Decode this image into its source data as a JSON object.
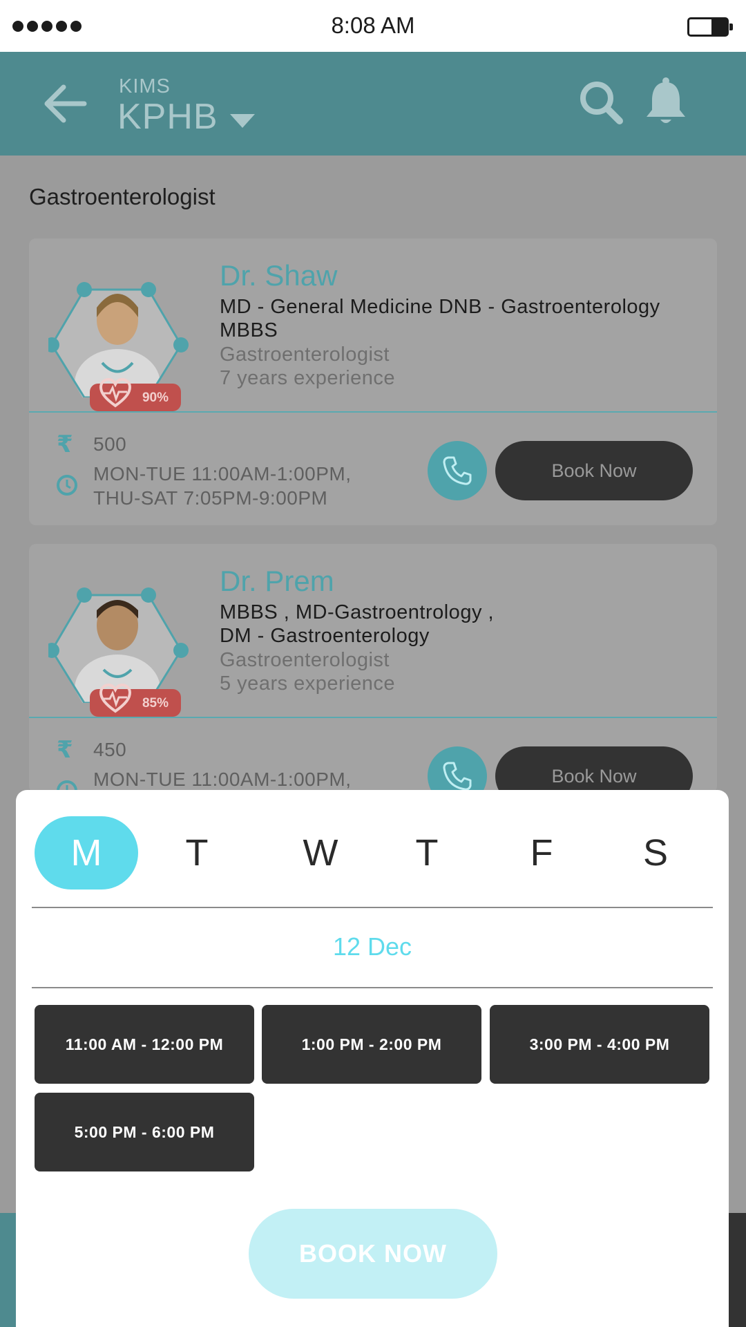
{
  "status_bar": {
    "time": "8:08 AM"
  },
  "header": {
    "hospital": "KIMS",
    "location": "KPHB"
  },
  "section_title": "Gastroenterologist",
  "doctors": [
    {
      "name": "Dr. Shaw",
      "quals": "MD - General Medicine DNB - Gastroenterology MBBS",
      "specialty": "Gastroenterologist",
      "experience": "7 years experience",
      "rating": "90%",
      "fee": "500",
      "timings": [
        "MON-TUE 11:00AM-1:00PM,",
        "THU-SAT 7:05PM-9:00PM"
      ],
      "book_label": "Book Now"
    },
    {
      "name": "Dr. Prem",
      "quals": "MBBS , MD-Gastroentrology , DM - Gastroenterology",
      "specialty": "Gastroenterologist",
      "experience": "5 years experience",
      "rating": "85%",
      "fee": "450",
      "timings": [
        "MON-TUE 11:00AM-1:00PM,",
        ""
      ],
      "book_label": "Book Now"
    }
  ],
  "booking_sheet": {
    "days": [
      "M",
      "T",
      "W",
      "T",
      "F",
      "S"
    ],
    "selected_day": "M",
    "date": "12 Dec",
    "slots": [
      "11:00 AM - 12:00 PM",
      "1:00 PM - 2:00 PM",
      "3:00 PM - 4:00 PM",
      "5:00 PM - 6:00 PM"
    ],
    "book_button": "BOOK NOW"
  },
  "colors": {
    "header": "#4e8a8f",
    "accent": "#5fdbec",
    "teal": "#4fa3ab",
    "rating_badge": "#c0504d",
    "dark_button": "#333333"
  },
  "icons": [
    "back-arrow-icon",
    "caret-down-icon",
    "search-icon",
    "bell-icon",
    "heart-icon",
    "rupee-icon",
    "clock-icon",
    "phone-icon"
  ]
}
